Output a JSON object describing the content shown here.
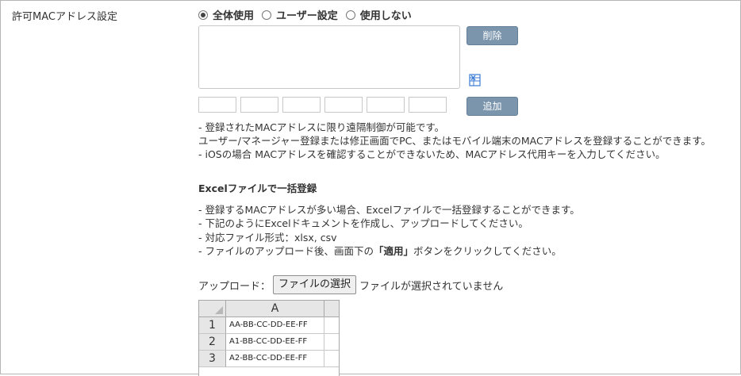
{
  "section": {
    "label": "許可MACアドレス設定"
  },
  "radio": {
    "options": [
      "全体使用",
      "ユーザー設定",
      "使用しない"
    ],
    "selected": "全体使用"
  },
  "buttons": {
    "delete": "削除",
    "add": "追加"
  },
  "icons": {
    "excel": "excel-icon"
  },
  "notes": [
    "- 登録されたMACアドレスに限り遠隔制御が可能です。",
    "ユーザー/マネージャー登録または修正画面でPC、またはモバイル端末のMACアドレスを登録することができます。",
    "- iOSの場合 MACアドレスを確認することができないため、MACアドレス代用キーを入力してください。"
  ],
  "excel": {
    "title": "Excelファイルで一括登録",
    "notes": [
      "- 登録するMACアドレスが多い場合、Excelファイルで一括登録することができます。",
      "- 下記のようにExcelドキュメントを作成し、アップロードしてください。",
      "- 対応ファイル形式：xlsx, csv"
    ],
    "note4_prefix": "- ファイルのアップロード後、画面下の",
    "note4_bold": "「適用」",
    "note4_suffix": "ボタンをクリックしてください。"
  },
  "upload": {
    "label": "アップロード：",
    "choose_button": "ファイルの選択",
    "status": "ファイルが選択されていません"
  },
  "sheet": {
    "column_header": "A",
    "rows": [
      {
        "num": "1",
        "value": "AA-BB-CC-DD-EE-FF"
      },
      {
        "num": "2",
        "value": "A1-BB-CC-DD-EE-FF"
      },
      {
        "num": "3",
        "value": "A2-BB-CC-DD-EE-FF"
      }
    ]
  }
}
